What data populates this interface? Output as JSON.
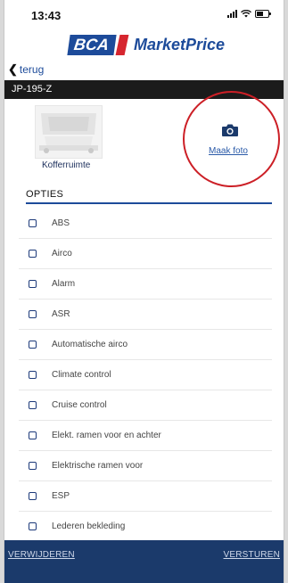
{
  "status_bar": {
    "time": "13:43"
  },
  "brand": {
    "bca": "BCA",
    "marketprice": "MarketPrice"
  },
  "nav": {
    "back_label": "terug"
  },
  "vehicle": {
    "plate": "JP-195-Z"
  },
  "photo": {
    "caption": "Kofferruimte",
    "action_label": "Maak foto"
  },
  "options": {
    "header": "OPTIES",
    "items": [
      "ABS",
      "Airco",
      "Alarm",
      "ASR",
      "Automatische airco",
      "Climate control",
      "Cruise control",
      "Elekt. ramen voor en achter",
      "Elektrische ramen voor",
      "ESP",
      "Lederen bekleding"
    ]
  },
  "footer": {
    "delete_label": "VERWIJDEREN",
    "send_label": "VERSTUREN"
  },
  "colors": {
    "brand_blue": "#1d4b9a",
    "brand_red": "#d6262f",
    "footer_bg": "#1b3a6b",
    "highlight": "#cc1f26"
  }
}
